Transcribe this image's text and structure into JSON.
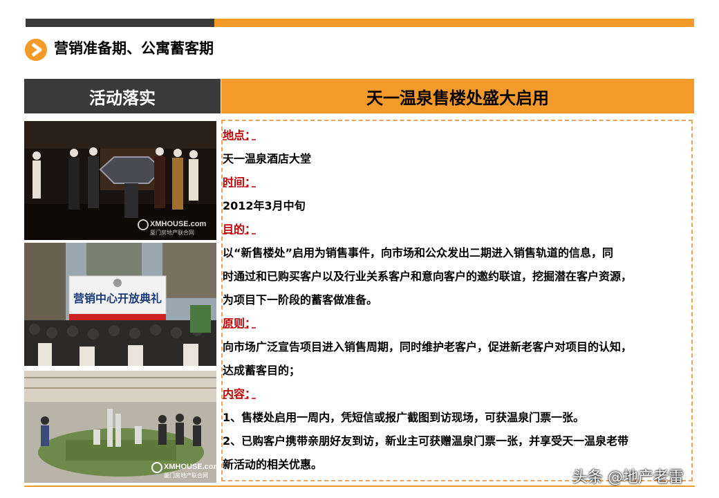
{
  "page_title": "营销准备期、公寓蓄客期",
  "header": {
    "left": "活动落实",
    "right": "天一温泉售楼处盛大启用"
  },
  "photos": {
    "photo1_watermark": "XMHOUSE.com",
    "photo1_sub": "厦门房地产联合网",
    "photo2_banner": "营销中心开放典礼",
    "photo3_watermark": "XMHOUSE.com",
    "photo3_sub": "厦门房地产联合网"
  },
  "content": {
    "location_label": "地点：",
    "location": "天一温泉酒店大堂",
    "time_label": "时间：",
    "time": "2012年3月中旬",
    "purpose_label": "目的：",
    "purpose_lines": [
      "以“新售楼处”启用为销售事件，向市场和公众发出二期进入销售轨道的信息，同",
      "时通过和已购买客户以及行业关系客户和意向客户的邀约联谊，挖掘潜在客户资源，",
      "为项目下一阶段的蓄客做准备。"
    ],
    "principle_label": "原则：",
    "principle_lines": [
      "向市场广泛宣告项目进入销售周期，同时维护老客户，促进新老客户对项目的认知，",
      "达成蓄客目的；"
    ],
    "contents_label": "内容：",
    "contents_lines": [
      "1、售楼处启用一周内，凭短信或报广截图到访现场，可获温泉门票一张。",
      "2、已购客户携带亲朋好友到访，新业主可获赠温泉门票一张，并享受天一温泉老带",
      "新活动的相关优惠。"
    ]
  },
  "watermark": "头条 @地产老雷",
  "colors": {
    "accent": "#f39a2b",
    "dark": "#3a3a3a",
    "label_red": "#c00000"
  }
}
